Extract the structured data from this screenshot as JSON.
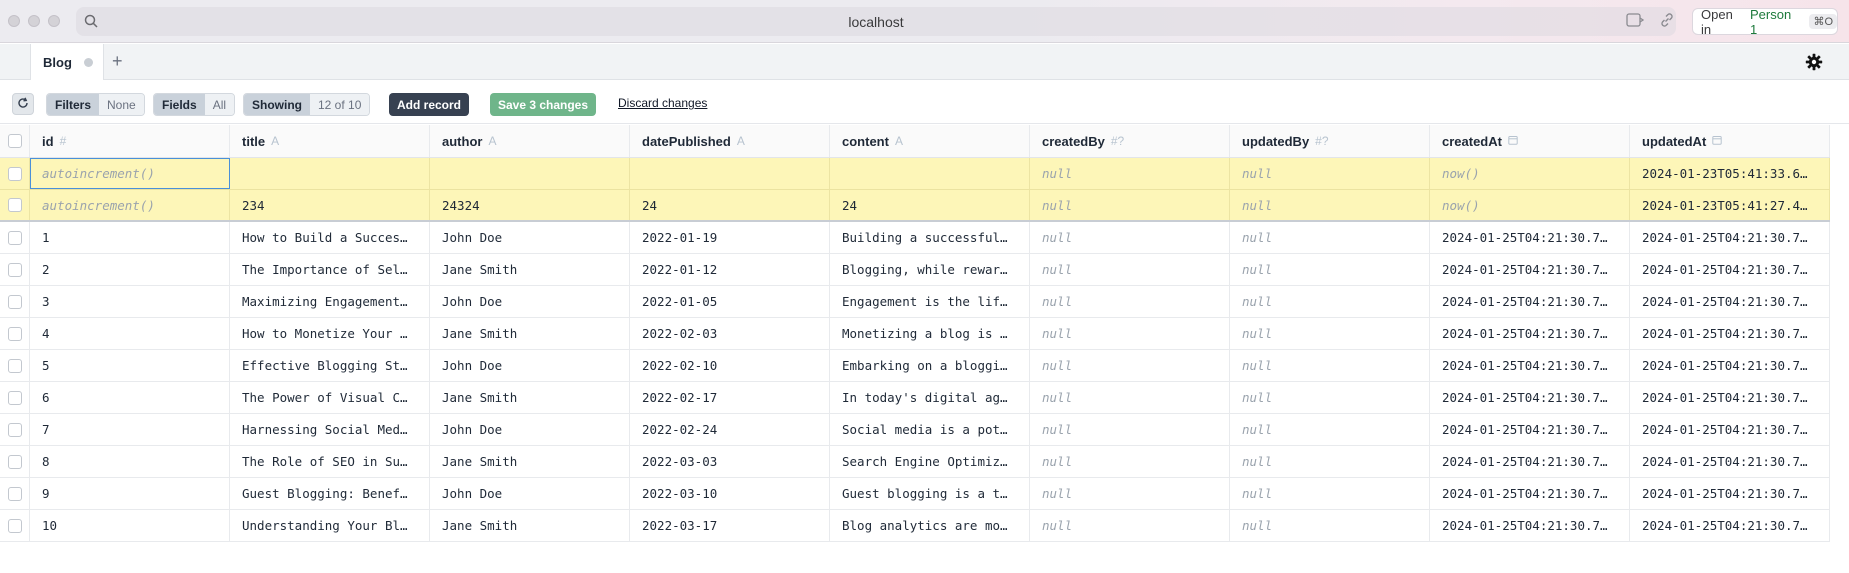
{
  "browser": {
    "url": "localhost",
    "open_in_label": "Open in",
    "open_in_profile": "Person 1",
    "open_in_shortcut": "⌘O"
  },
  "tabs": [
    {
      "label": "Blog"
    }
  ],
  "toolbar": {
    "filters_label": "Filters",
    "filters_value": "None",
    "fields_label": "Fields",
    "fields_value": "All",
    "showing_label": "Showing",
    "showing_value": "12 of 10",
    "add_record_label": "Add record",
    "save_label": "Save 3 changes",
    "discard_label": "Discard changes"
  },
  "columns": [
    {
      "name": "id",
      "type_icon": "#"
    },
    {
      "name": "title",
      "type_icon": "A"
    },
    {
      "name": "author",
      "type_icon": "A"
    },
    {
      "name": "datePublished",
      "type_icon": "A"
    },
    {
      "name": "content",
      "type_icon": "A"
    },
    {
      "name": "createdBy",
      "type_icon": "#?"
    },
    {
      "name": "updatedBy",
      "type_icon": "#?"
    },
    {
      "name": "createdAt",
      "type_icon": "calendar-icon"
    },
    {
      "name": "updatedAt",
      "type_icon": "calendar-icon"
    }
  ],
  "pending_rows": [
    [
      "autoincrement()",
      "",
      "",
      "",
      "",
      "null",
      "null",
      "now()",
      "2024-01-23T05:41:33.6…"
    ],
    [
      "autoincrement()",
      "234",
      "24324",
      "24",
      "24",
      "null",
      "null",
      "now()",
      "2024-01-23T05:41:27.4…"
    ]
  ],
  "rows": [
    [
      "1",
      "How to Build a Succes…",
      "John Doe",
      "2022-01-19",
      "Building a successful…",
      "null",
      "null",
      "2024-01-25T04:21:30.7…",
      "2024-01-25T04:21:30.7…"
    ],
    [
      "2",
      "The Importance of Sel…",
      "Jane Smith",
      "2022-01-12",
      "Blogging, while rewar…",
      "null",
      "null",
      "2024-01-25T04:21:30.7…",
      "2024-01-25T04:21:30.7…"
    ],
    [
      "3",
      "Maximizing Engagement…",
      "John Doe",
      "2022-01-05",
      "Engagement is the lif…",
      "null",
      "null",
      "2024-01-25T04:21:30.7…",
      "2024-01-25T04:21:30.7…"
    ],
    [
      "4",
      "How to Monetize Your …",
      "Jane Smith",
      "2022-02-03",
      "Monetizing a blog is …",
      "null",
      "null",
      "2024-01-25T04:21:30.7…",
      "2024-01-25T04:21:30.7…"
    ],
    [
      "5",
      "Effective Blogging St…",
      "John Doe",
      "2022-02-10",
      "Embarking on a bloggi…",
      "null",
      "null",
      "2024-01-25T04:21:30.7…",
      "2024-01-25T04:21:30.7…"
    ],
    [
      "6",
      "The Power of Visual C…",
      "Jane Smith",
      "2022-02-17",
      "In today's digital ag…",
      "null",
      "null",
      "2024-01-25T04:21:30.7…",
      "2024-01-25T04:21:30.7…"
    ],
    [
      "7",
      "Harnessing Social Med…",
      "John Doe",
      "2022-02-24",
      "Social media is a pot…",
      "null",
      "null",
      "2024-01-25T04:21:30.7…",
      "2024-01-25T04:21:30.7…"
    ],
    [
      "8",
      "The Role of SEO in Su…",
      "Jane Smith",
      "2022-03-03",
      "Search Engine Optimiz…",
      "null",
      "null",
      "2024-01-25T04:21:30.7…",
      "2024-01-25T04:21:30.7…"
    ],
    [
      "9",
      "Guest Blogging: Benef…",
      "John Doe",
      "2022-03-10",
      "Guest blogging is a t…",
      "null",
      "null",
      "2024-01-25T04:21:30.7…",
      "2024-01-25T04:21:30.7…"
    ],
    [
      "10",
      "Understanding Your Bl…",
      "Jane Smith",
      "2022-03-17",
      "Blog analytics are mo…",
      "null",
      "null",
      "2024-01-25T04:21:30.7…",
      "2024-01-25T04:21:30.7…"
    ]
  ]
}
